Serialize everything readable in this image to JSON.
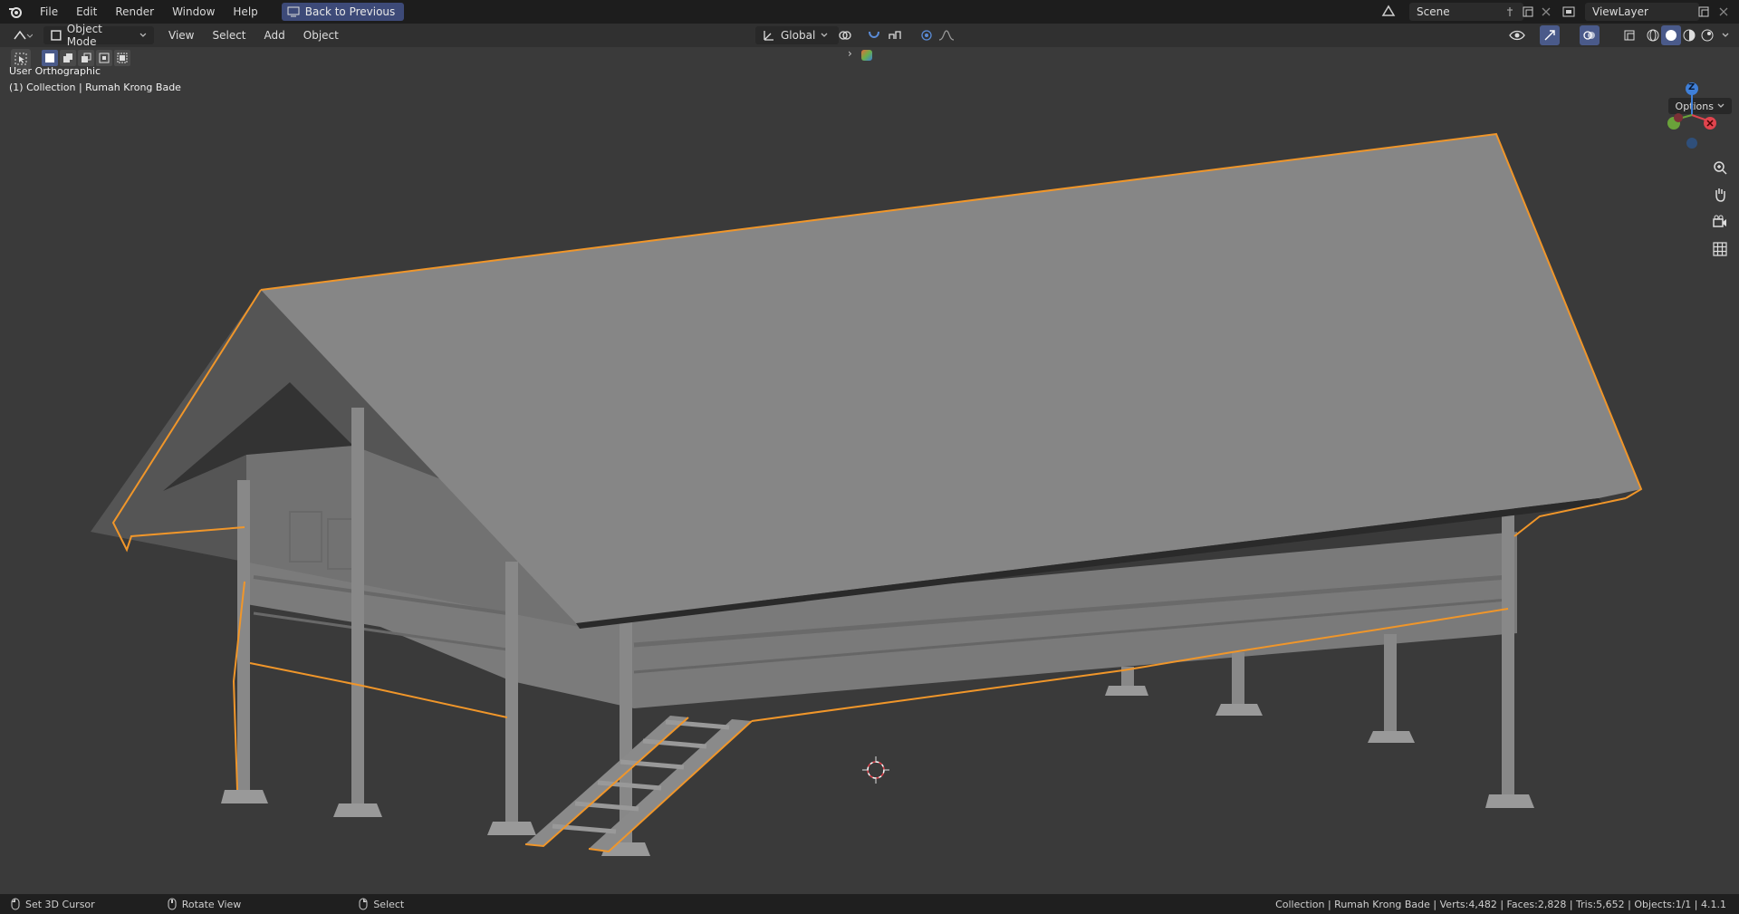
{
  "topbar": {
    "menu": [
      "File",
      "Edit",
      "Render",
      "Window",
      "Help"
    ],
    "back_button": "Back to Previous",
    "scene": "Scene",
    "view_layer": "ViewLayer"
  },
  "header": {
    "mode": "Object Mode",
    "menus": [
      "View",
      "Select",
      "Add",
      "Object"
    ],
    "transform_orientation": "Global"
  },
  "viewport": {
    "view_label": "User Orthographic",
    "collection_label": "(1) Collection | Rumah Krong Bade",
    "options_label": "Options",
    "gizmo_axis": "Z"
  },
  "statusbar": {
    "hint_1": "Set 3D Cursor",
    "hint_2": "Rotate View",
    "hint_3": "Select",
    "stats": "Collection | Rumah Krong Bade | Verts:4,482 | Faces:2,828 | Tris:5,652 | Objects:1/1 | 4.1.1"
  },
  "colors": {
    "accent": "#3d4a78",
    "selection_outline": "#f0962a",
    "axis_x": "#e0444e",
    "axis_y": "#6aa23a",
    "axis_z": "#3f7fd8"
  }
}
